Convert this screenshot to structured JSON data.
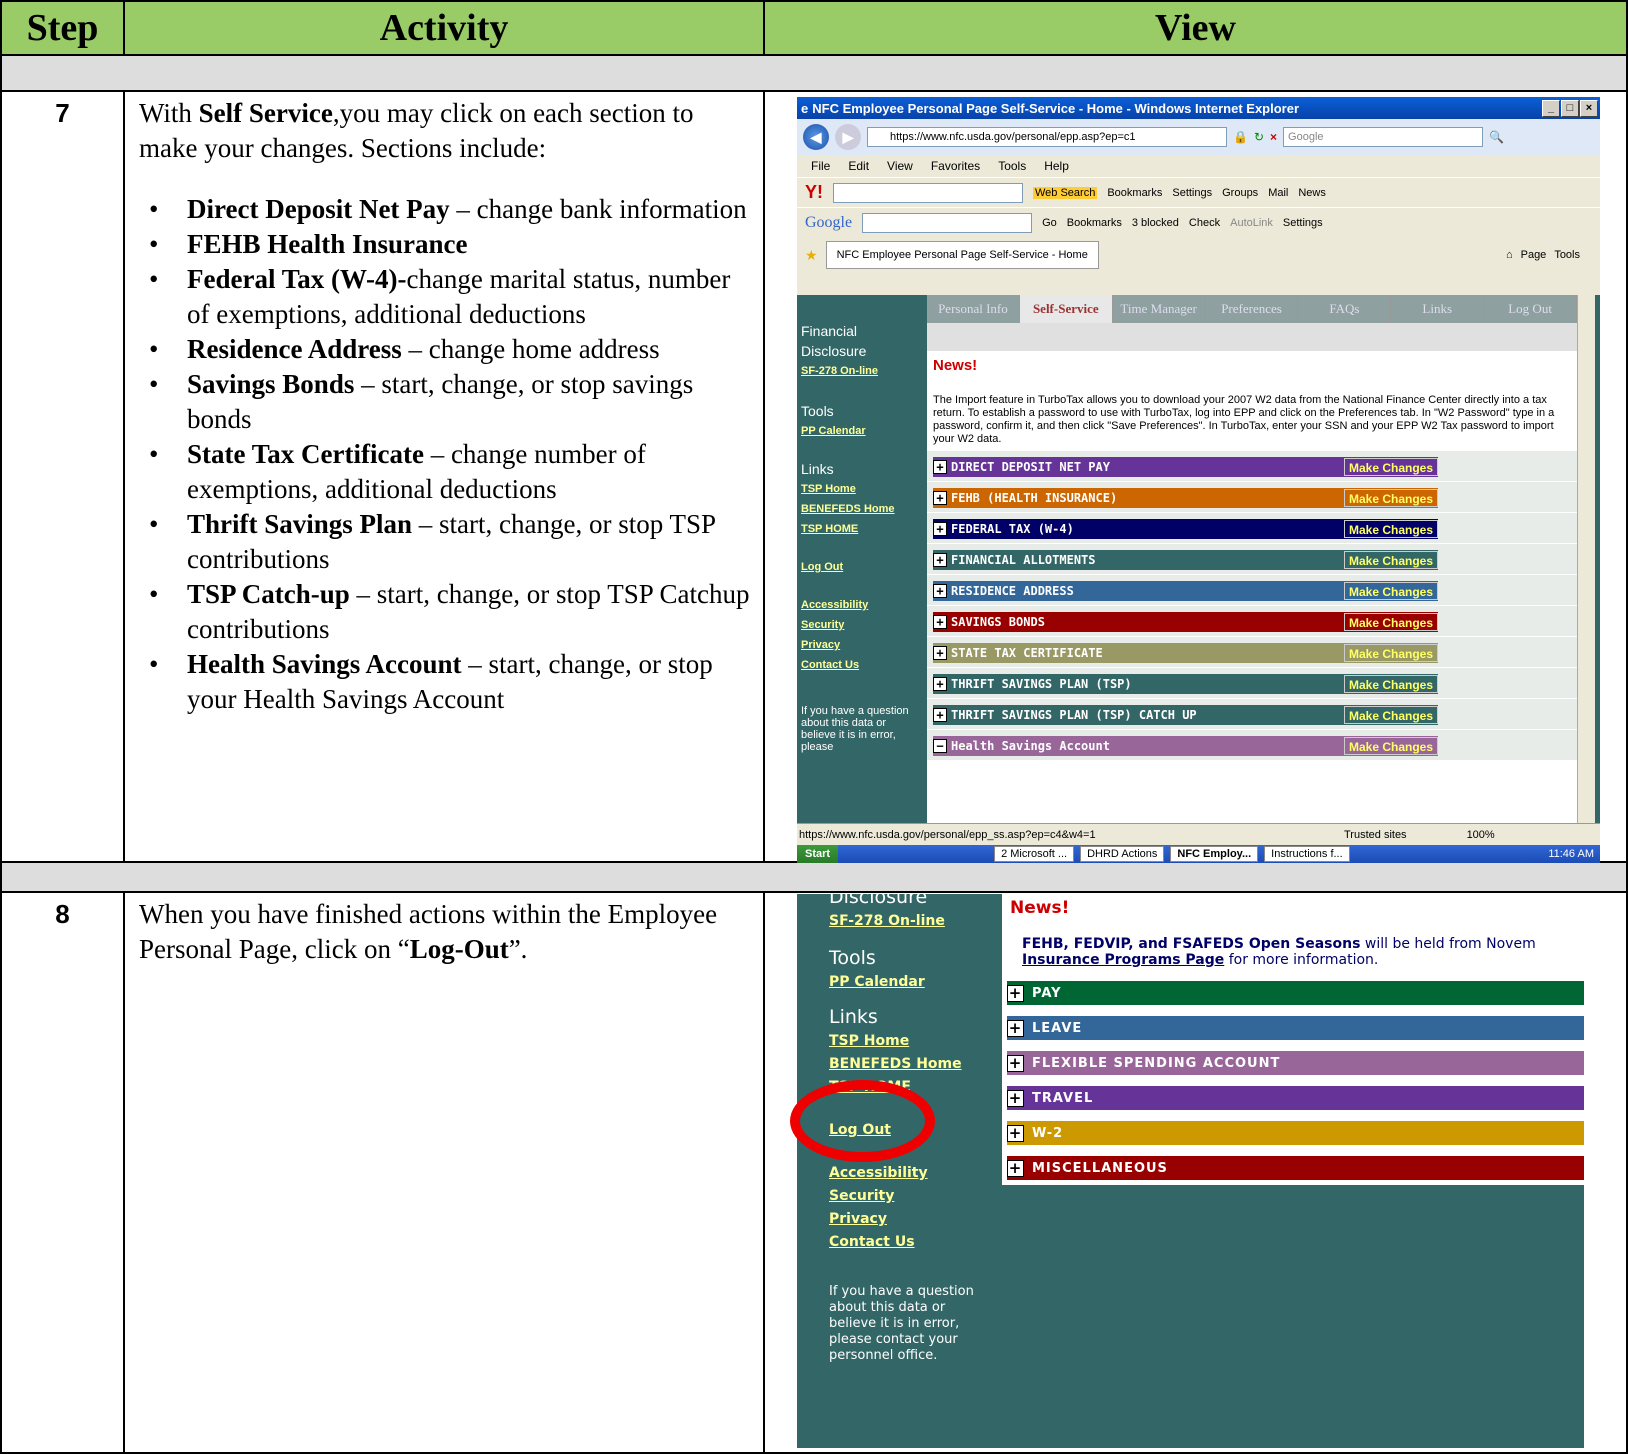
{
  "header": {
    "step": "Step",
    "activity": "Activity",
    "view": "View"
  },
  "step7": {
    "number": "7",
    "intro_bold": "Self Service",
    "intro_pre": "With ",
    "intro_post": ",you may click on each section to make your changes.  Sections include:",
    "bullets": [
      {
        "bold": "Direct Deposit Net Pay",
        "text": " – change bank information"
      },
      {
        "bold": "FEHB Health Insurance",
        "text": ""
      },
      {
        "bold": "Federal Tax (W-4)-",
        "text": "change marital status, number of exemptions, additional deductions"
      },
      {
        "bold": "Residence Address",
        "text": " – change home address"
      },
      {
        "bold": "Savings Bonds",
        "text": " – start, change, or stop savings bonds"
      },
      {
        "bold": "State Tax Certificate",
        "text": " – change number of exemptions, additional deductions"
      },
      {
        "bold": "Thrift Savings Plan",
        "text": " – start, change, or stop TSP contributions"
      },
      {
        "bold": "TSP Catch-up",
        "text": " – start, change, or stop TSP Catchup contributions"
      },
      {
        "bold": "Health Savings Account",
        "text": " – start, change, or stop your Health Savings Account"
      }
    ]
  },
  "browser": {
    "title": "NFC Employee Personal Page Self-Service - Home - Windows Internet Explorer",
    "url": "https://www.nfc.usda.gov/personal/epp.asp?ep=c1",
    "search_placeholder": "Google",
    "menu": [
      "File",
      "Edit",
      "View",
      "Favorites",
      "Tools",
      "Help"
    ],
    "yahoo_toolbar": [
      "Web Search",
      "Bookmarks",
      "Settings",
      "Groups",
      "Mail",
      "News"
    ],
    "google_toolbar": [
      "Go",
      "Bookmarks",
      "3 blocked",
      "Check",
      "AutoLink",
      "Settings"
    ],
    "tab": "NFC Employee Personal Page Self-Service - Home",
    "cmd": [
      "Page",
      "Tools"
    ],
    "nav": [
      "Personal Info",
      "Self-Service",
      "Time Manager",
      "Preferences",
      "FAQs",
      "Links",
      "Log Out"
    ],
    "left": {
      "fd": "Financial Disclosure",
      "sf": "SF-278 On-line",
      "tools": "Tools",
      "ppc": "PP Calendar",
      "links": "Links",
      "tsp": "TSP Home",
      "ben": "BENEFEDS Home",
      "tsp2": "TSP HOME",
      "logout": "Log Out",
      "acc": "Accessibility",
      "sec": "Security",
      "priv": "Privacy",
      "contact": "Contact Us",
      "note": "If you have a question about this data or believe it is in error, please"
    },
    "news_title": "News!",
    "news_text": "The Import feature in TurboTax allows you to download your 2007 W2 data from the National Finance Center directly into a tax return. To establish a password to use with TurboTax, log into EPP and click on the Preferences tab. In \"W2 Password\" type in a password, confirm it, and then click \"Save Preferences\". In TurboTax, enter your SSN and your EPP W2 Tax password to import your W2 data.",
    "make_changes": "Make Changes",
    "sections": [
      {
        "label": "DIRECT DEPOSIT NET PAY",
        "color": "#663399"
      },
      {
        "label": "FEHB (HEALTH INSURANCE)",
        "color": "#cc6600"
      },
      {
        "label": "FEDERAL TAX (W-4)",
        "color": "#000066"
      },
      {
        "label": "FINANCIAL ALLOTMENTS",
        "color": "#336666"
      },
      {
        "label": "RESIDENCE ADDRESS",
        "color": "#336699"
      },
      {
        "label": "SAVINGS BONDS",
        "color": "#990000"
      },
      {
        "label": "STATE TAX CERTIFICATE",
        "color": "#999966"
      },
      {
        "label": "THRIFT SAVINGS PLAN (TSP)",
        "color": "#336666"
      },
      {
        "label": "THRIFT SAVINGS PLAN (TSP) CATCH UP",
        "color": "#336666"
      },
      {
        "label": "Health Savings Account",
        "color": "#996699"
      }
    ],
    "status_url": "https://www.nfc.usda.gov/personal/epp_ss.asp?ep=c4&w4=1",
    "trusted": "Trusted sites",
    "zoom": "100%",
    "taskbar": {
      "start": "Start",
      "items": [
        "2 Microsoft ...",
        "DHRD Actions",
        "NFC Employ...",
        "Instructions f..."
      ],
      "time": "11:46 AM"
    }
  },
  "step8": {
    "number": "8",
    "text_pre": "When you have finished actions within the Employee Personal Page, click on “",
    "text_bold": "Log-Out",
    "text_post": "”."
  },
  "zoom": {
    "fd": "Disclosure",
    "sf": "SF-278 On-line",
    "tools": "Tools",
    "ppc": "PP Calendar",
    "links": "Links",
    "tsp": "TSP Home",
    "ben": "BENEFEDS Home",
    "tsp2": "TSP HOME",
    "logout": "Log Out",
    "acc": "Accessibility",
    "sec": "Security",
    "priv": "Privacy",
    "contact": "Contact Us",
    "note": "If you have a question about this data or believe it is in error, please contact your personnel office.",
    "news": "News!",
    "news_bold": "FEHB, FEDVIP, and FSAFEDS Open Seasons",
    "news_rest": " will be held from Novem",
    "news_link": "Insurance Programs Page",
    "news_tail": " for more information.",
    "sections": [
      {
        "label": "PAY",
        "color": "#006633"
      },
      {
        "label": "LEAVE",
        "color": "#336699"
      },
      {
        "label": "FLEXIBLE SPENDING ACCOUNT",
        "color": "#996699"
      },
      {
        "label": "TRAVEL",
        "color": "#663399"
      },
      {
        "label": "W-2",
        "color": "#cc9900"
      },
      {
        "label": "MISCELLANEOUS",
        "color": "#990000"
      }
    ]
  }
}
